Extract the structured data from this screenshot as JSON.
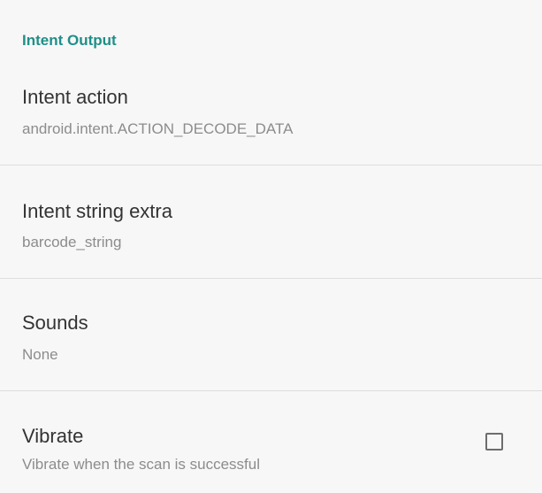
{
  "settings": {
    "category_title": "Intent Output",
    "items": [
      {
        "title": "Intent action",
        "summary": "android.intent.ACTION_DECODE_DATA"
      },
      {
        "title": "Intent string extra",
        "summary": "barcode_string"
      },
      {
        "title": "Sounds",
        "summary": "None"
      },
      {
        "title": "Vibrate",
        "summary": "Vibrate when the scan is successful",
        "checkbox_checked": false
      }
    ]
  },
  "colors": {
    "accent": "#1f8f88",
    "background": "#f7f7f7",
    "title_text": "#333333",
    "summary_text": "#8c8c8c",
    "divider": "#dedede"
  }
}
